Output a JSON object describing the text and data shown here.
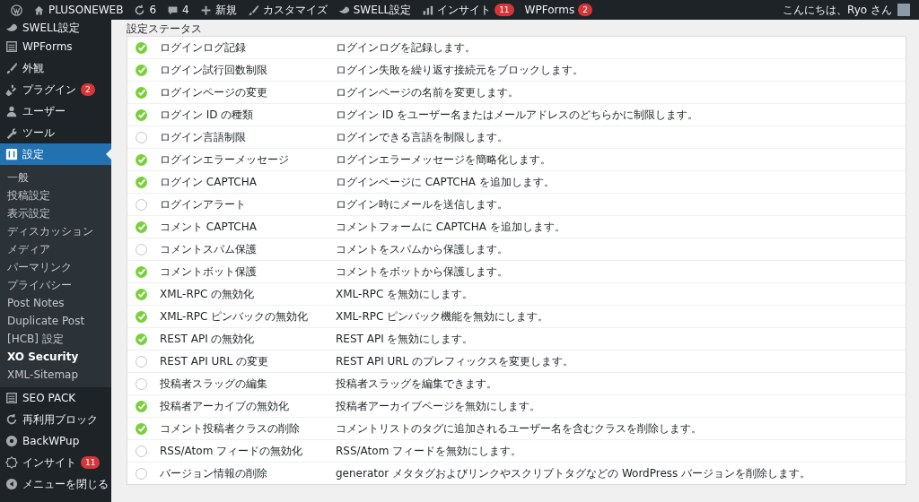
{
  "admin_bar": {
    "items": [
      {
        "kind": "logo"
      },
      {
        "kind": "home",
        "label": "PLUSONEWEB"
      },
      {
        "kind": "updates",
        "label": "6"
      },
      {
        "kind": "comments",
        "label": "4"
      },
      {
        "kind": "new",
        "label": "新規"
      },
      {
        "kind": "customize",
        "label": "カスタマイズ"
      },
      {
        "kind": "swell",
        "label": "SWELL設定"
      },
      {
        "kind": "insight",
        "label": "インサイト",
        "badge": "11"
      },
      {
        "kind": "plain",
        "label": "WPForms",
        "badge": "2"
      }
    ],
    "greeting": "こんにちは、Ryo さん"
  },
  "sidebar": {
    "items": [
      {
        "kind": "swell",
        "label": "SWELL設定",
        "selected": false
      },
      {
        "kind": "forms",
        "label": "WPForms",
        "selected": false
      },
      {
        "kind": "brush",
        "label": "外観",
        "selected": false
      },
      {
        "kind": "plug",
        "label": "プラグイン",
        "badge": "2",
        "selected": false
      },
      {
        "kind": "user",
        "label": "ユーザー",
        "selected": false
      },
      {
        "kind": "wrench",
        "label": "ツール",
        "selected": false
      },
      {
        "kind": "settings",
        "label": "設定",
        "selected": true,
        "children": [
          {
            "label": "一般",
            "selected": false
          },
          {
            "label": "投稿設定",
            "selected": false
          },
          {
            "label": "表示設定",
            "selected": false
          },
          {
            "label": "ディスカッション",
            "selected": false
          },
          {
            "label": "メディア",
            "selected": false
          },
          {
            "label": "パーマリンク",
            "selected": false
          },
          {
            "label": "プライバシー",
            "selected": false
          },
          {
            "label": "Post Notes",
            "selected": false
          },
          {
            "label": "Duplicate Post",
            "selected": false
          },
          {
            "label": "[HCB] 設定",
            "selected": false
          },
          {
            "label": "XO Security",
            "selected": true
          },
          {
            "label": "XML-Sitemap",
            "selected": false
          }
        ]
      },
      {
        "kind": "list",
        "label": "SEO PACK",
        "selected": false
      },
      {
        "kind": "reuse",
        "label": "再利用ブロック",
        "selected": false
      },
      {
        "kind": "backup",
        "label": "BackWPup",
        "selected": false
      },
      {
        "kind": "insight",
        "label": "インサイト",
        "badge": "11",
        "selected": false
      },
      {
        "kind": "collapse",
        "label": "メニューを閉じる",
        "selected": false
      }
    ]
  },
  "heading": "設定ステータス",
  "rows": [
    {
      "enabled": true,
      "name": "ログインログ記録",
      "description": "ログインログを記録します。"
    },
    {
      "enabled": true,
      "name": "ログイン試行回数制限",
      "description": "ログイン失敗を繰り返す接続元をブロックします。"
    },
    {
      "enabled": true,
      "name": "ログインページの変更",
      "description": "ログインページの名前を変更します。"
    },
    {
      "enabled": true,
      "name": "ログイン ID の種類",
      "description": "ログイン ID をユーザー名またはメールアドレスのどちらかに制限します。"
    },
    {
      "enabled": false,
      "name": "ログイン言語制限",
      "description": "ログインできる言語を制限します。"
    },
    {
      "enabled": true,
      "name": "ログインエラーメッセージ",
      "description": "ログインエラーメッセージを簡略化します。"
    },
    {
      "enabled": true,
      "name": "ログイン CAPTCHA",
      "description": "ログインページに CAPTCHA を追加します。"
    },
    {
      "enabled": false,
      "name": "ログインアラート",
      "description": "ログイン時にメールを送信します。"
    },
    {
      "enabled": true,
      "name": "コメント CAPTCHA",
      "description": "コメントフォームに CAPTCHA を追加します。"
    },
    {
      "enabled": false,
      "name": "コメントスパム保護",
      "description": "コメントをスパムから保護します。"
    },
    {
      "enabled": true,
      "name": "コメントボット保護",
      "description": "コメントをボットから保護します。"
    },
    {
      "enabled": true,
      "name": "XML-RPC の無効化",
      "description": "XML-RPC を無効にします。"
    },
    {
      "enabled": true,
      "name": "XML-RPC ピンバックの無効化",
      "description": "XML-RPC ピンバック機能を無効にします。"
    },
    {
      "enabled": true,
      "name": "REST API の無効化",
      "description": "REST API を無効にします。"
    },
    {
      "enabled": false,
      "name": "REST API URL の変更",
      "description": "REST API URL のプレフィックスを変更します。"
    },
    {
      "enabled": false,
      "name": "投稿者スラッグの編集",
      "description": "投稿者スラッグを編集できます。"
    },
    {
      "enabled": true,
      "name": "投稿者アーカイブの無効化",
      "description": "投稿者アーカイブページを無効にします。"
    },
    {
      "enabled": true,
      "name": "コメント投稿者クラスの削除",
      "description": "コメントリストのタグに追加されるユーザー名を含むクラスを削除します。"
    },
    {
      "enabled": false,
      "name": "RSS/Atom フィードの無効化",
      "description": "RSS/Atom フィードを無効にします。"
    },
    {
      "enabled": false,
      "name": "バージョン情報の削除",
      "description": "generator メタタグおよびリンクやスクリプトタグなどの WordPress バージョンを削除します。"
    }
  ]
}
